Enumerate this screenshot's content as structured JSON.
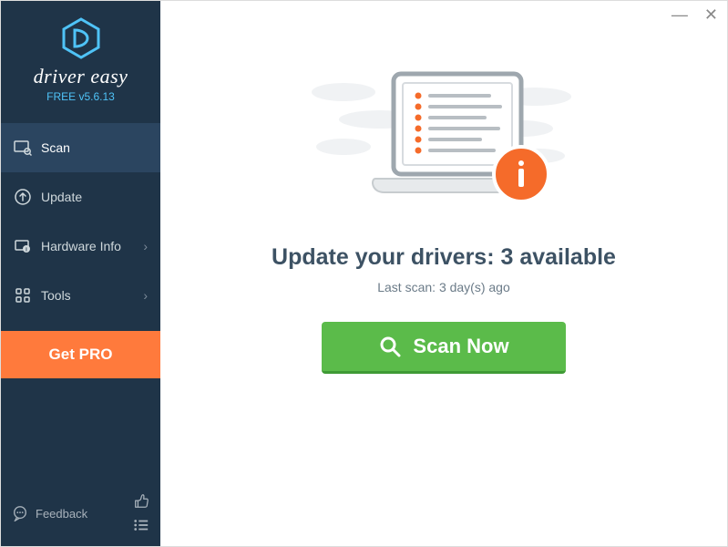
{
  "brand": {
    "name": "driver easy",
    "version": "FREE v5.6.13"
  },
  "sidebar": {
    "items": [
      {
        "label": "Scan",
        "has_chevron": false
      },
      {
        "label": "Update",
        "has_chevron": false
      },
      {
        "label": "Hardware Info",
        "has_chevron": true
      },
      {
        "label": "Tools",
        "has_chevron": true
      }
    ],
    "get_pro_label": "Get PRO",
    "feedback_label": "Feedback"
  },
  "main": {
    "heading": "Update your drivers: 3 available",
    "subheading": "Last scan: 3 day(s) ago",
    "scan_button": "Scan Now"
  }
}
